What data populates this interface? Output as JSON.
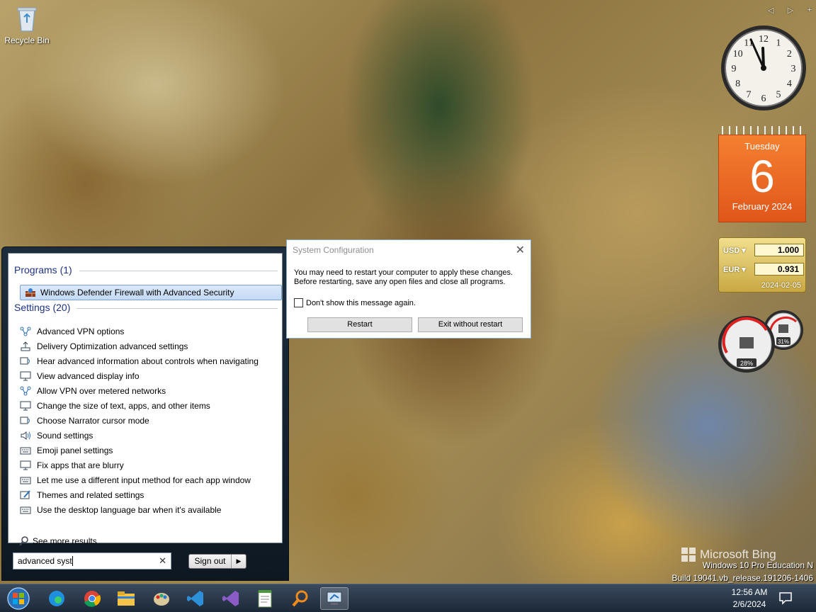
{
  "desktop": {
    "recycle_bin_label": "Recycle Bin"
  },
  "gadgets": {
    "controls": [
      "◁",
      "▷",
      "+"
    ],
    "clock": {
      "hour": 11,
      "minute": 56,
      "numerals": [
        "12",
        "1",
        "2",
        "3",
        "4",
        "5",
        "6",
        "7",
        "8",
        "9",
        "10",
        "11"
      ]
    },
    "calendar": {
      "weekday": "Tuesday",
      "day": "6",
      "month_year": "February 2024"
    },
    "currency": {
      "rows": [
        {
          "code": "USD",
          "value": "1.000"
        },
        {
          "code": "EUR",
          "value": "0.931"
        }
      ],
      "date": "2024-02-05"
    },
    "meter": {
      "cpu_percent": "28%",
      "memory_percent": "31%"
    }
  },
  "start_menu": {
    "programs_header": "Programs (1)",
    "programs": [
      {
        "label": "Windows Defender Firewall with Advanced Security"
      }
    ],
    "settings_header": "Settings (20)",
    "settings": [
      {
        "label": "Advanced VPN options",
        "icon": "network-icon"
      },
      {
        "label": "Delivery Optimization advanced settings",
        "icon": "upload-icon"
      },
      {
        "label": "Hear advanced information about controls when navigating",
        "icon": "narrator-icon"
      },
      {
        "label": "View advanced display info",
        "icon": "monitor-icon"
      },
      {
        "label": "Allow VPN over metered networks",
        "icon": "network-icon"
      },
      {
        "label": "Change the size of text, apps, and other items",
        "icon": "monitor-icon"
      },
      {
        "label": "Choose Narrator cursor mode",
        "icon": "narrator-icon"
      },
      {
        "label": "Sound settings",
        "icon": "speaker-icon"
      },
      {
        "label": "Emoji panel settings",
        "icon": "keyboard-icon"
      },
      {
        "label": "Fix apps that are blurry",
        "icon": "monitor-icon"
      },
      {
        "label": "Let me use a different input method for each app window",
        "icon": "keyboard-icon"
      },
      {
        "label": "Themes and related settings",
        "icon": "brush-icon"
      },
      {
        "label": "Use the desktop language bar when it's available",
        "icon": "keyboard-icon"
      }
    ],
    "see_more": "See more results",
    "search_value": "advanced syst",
    "sign_out": "Sign out"
  },
  "dialog": {
    "title": "System Configuration",
    "message_line1": "You may need to restart your computer to apply these changes.",
    "message_line2": "Before restarting, save any open files and close all programs.",
    "checkbox_label": "Don't show this message again.",
    "checkbox_checked": false,
    "restart_label": "Restart",
    "exit_label": "Exit without restart"
  },
  "watermark": {
    "bing": "Microsoft Bing",
    "edition": "Windows 10 Pro Education N",
    "build": "Build 19041.vb_release.191206-1406"
  },
  "taskbar": {
    "time": "12:56 AM",
    "date": "2/6/2024",
    "apps": [
      "start-orb-icon",
      "edge-icon",
      "chrome-icon",
      "file-explorer-icon",
      "paint-icon",
      "vscode-icon",
      "visual-studio-icon",
      "notepad-icon",
      "search-magnifier-icon",
      "system-config-icon"
    ]
  },
  "colors": {
    "taskbar": "#1c2838",
    "calendar": "#e0561a",
    "header_blue": "#1e3287",
    "selection": "#c3d9f5"
  }
}
